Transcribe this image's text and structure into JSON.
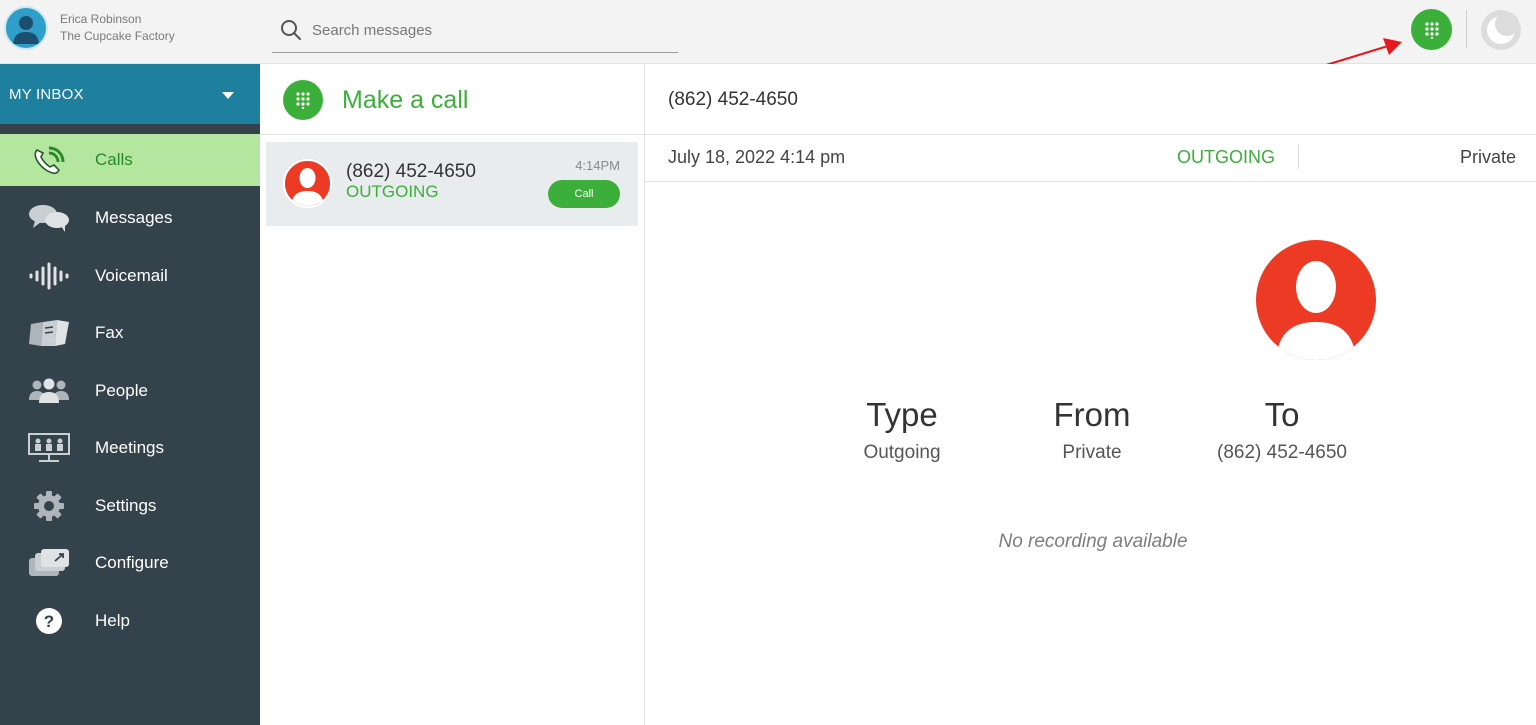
{
  "user": {
    "name": "Erica Robinson",
    "company": "The Cupcake Factory"
  },
  "search": {
    "placeholder": "Search messages"
  },
  "sidebar": {
    "inbox_label": "MY INBOX",
    "items": [
      {
        "label": "Calls",
        "icon": "phone-icon",
        "active": true
      },
      {
        "label": "Messages",
        "icon": "chat-bubbles-icon",
        "active": false
      },
      {
        "label": "Voicemail",
        "icon": "voicemail-wave-icon",
        "active": false
      },
      {
        "label": "Fax",
        "icon": "fax-icon",
        "active": false
      },
      {
        "label": "People",
        "icon": "people-icon",
        "active": false
      },
      {
        "label": "Meetings",
        "icon": "meetings-icon",
        "active": false
      },
      {
        "label": "Settings",
        "icon": "gear-icon",
        "active": false
      },
      {
        "label": "Configure",
        "icon": "configure-icon",
        "active": false
      },
      {
        "label": "Help",
        "icon": "help-icon",
        "active": false
      }
    ]
  },
  "list": {
    "make_call_label": "Make a call",
    "calls": [
      {
        "number": "(862) 452-4650",
        "direction": "OUTGOING",
        "time": "4:14PM",
        "button_label": "Call"
      }
    ]
  },
  "detail": {
    "number": "(862) 452-4650",
    "date": "July 18, 2022 4:14 pm",
    "direction": "OUTGOING",
    "privacy": "Private",
    "type_heading": "Type",
    "type_value": "Outgoing",
    "from_heading": "From",
    "from_value": "Private",
    "to_heading": "To",
    "to_value": "(862) 452-4650",
    "no_recording": "No recording available"
  },
  "colors": {
    "accent_green": "#3cae3a",
    "sidebar_bg": "#34424b",
    "inbox_header_bg": "#1f7f9f",
    "active_item_bg": "#b5e6a0",
    "contact_red": "#ec3a24",
    "annotation_red": "#e8191c"
  }
}
